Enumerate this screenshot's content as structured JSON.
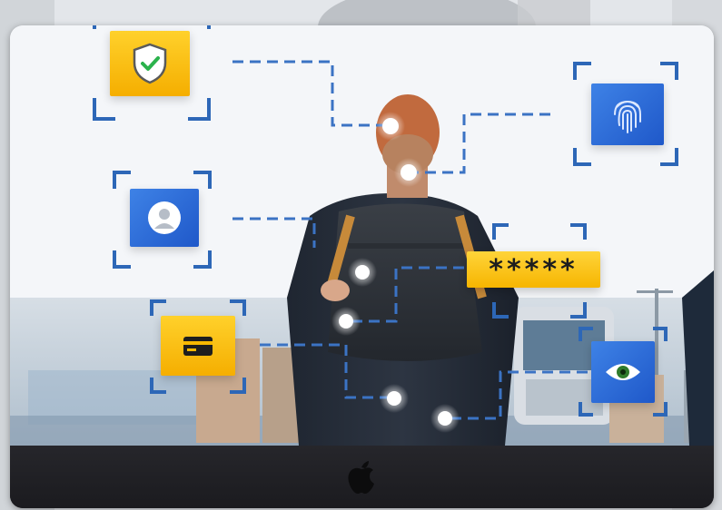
{
  "scene": {
    "password_mask": "*****",
    "colors": {
      "accent_blue": "#2a66d4",
      "accent_yellow": "#f7b800",
      "bracket_blue": "#2d67b7",
      "connector_dash": "#3b73c4"
    },
    "icons": [
      "shield-check-icon",
      "fingerprint-icon",
      "user-avatar-icon",
      "password-field",
      "credit-card-icon",
      "eye-icon"
    ]
  },
  "device": {
    "logo_icon": "apple-logo-icon"
  }
}
